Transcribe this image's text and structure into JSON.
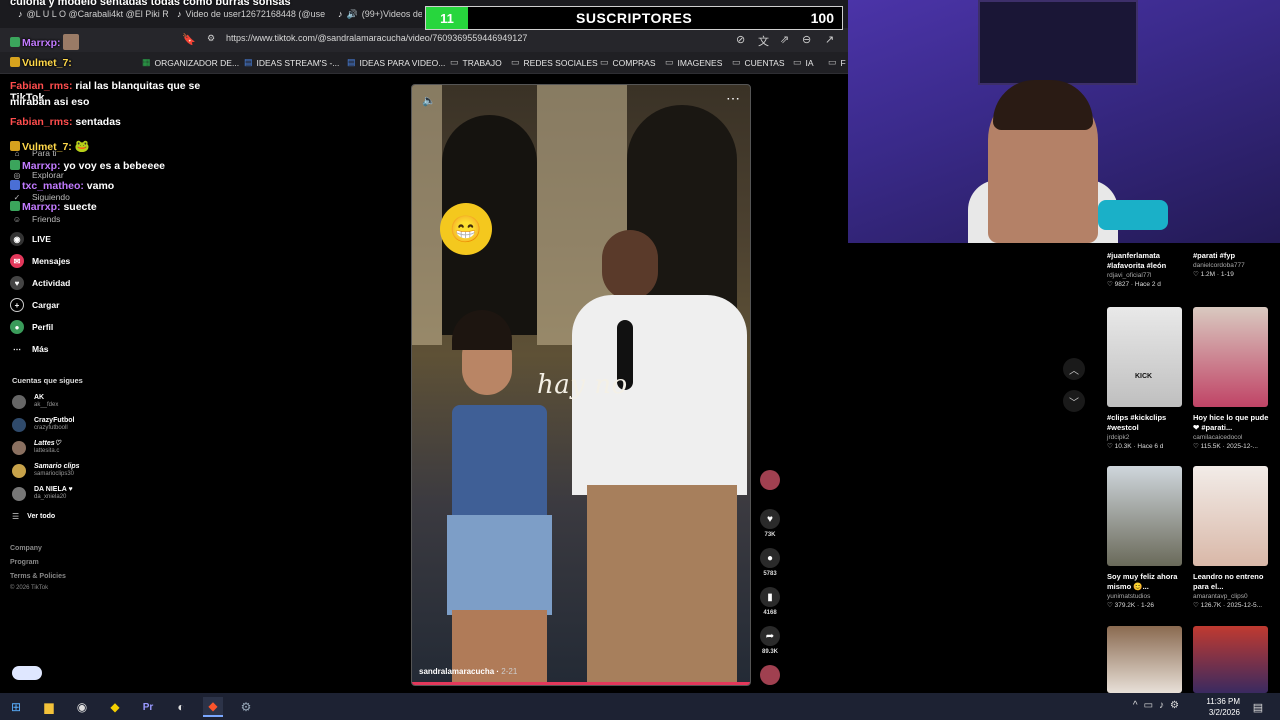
{
  "browser": {
    "tabs": [
      {
        "label": "@L U L O @Carabali4kt @El Piki Rey",
        "icon": "tiktok"
      },
      {
        "label": "Video de user12672168448 (@userm",
        "icon": "tiktok"
      },
      {
        "label": "(99+)Videos de",
        "icon": "tiktok"
      }
    ],
    "url": "https://www.tiktok.com/@sandralamaracucha/video/7609369559446949127",
    "bookmarks": [
      {
        "label": "ORGANIZADOR DE...",
        "icon": "sheet-icon"
      },
      {
        "label": "IDEAS STREAM'S -...",
        "icon": "doc-icon"
      },
      {
        "label": "IDEAS PARA VIDEO...",
        "icon": "doc-icon"
      },
      {
        "label": "TRABAJO",
        "icon": "folder-icon"
      },
      {
        "label": "REDES SOCIALES",
        "icon": "folder-icon"
      },
      {
        "label": "COMPRAS",
        "icon": "folder-icon"
      },
      {
        "label": "IMAGENES",
        "icon": "folder-icon"
      },
      {
        "label": "CUENTAS",
        "icon": "folder-icon"
      },
      {
        "label": "IA",
        "icon": "folder-icon"
      },
      {
        "label": "F",
        "icon": "folder-icon"
      }
    ]
  },
  "overlay": {
    "subs_current": "11",
    "subs_label": "SUSCRIPTORES",
    "subs_goal": "100",
    "header_text": "culona y modelo sentadas todas como burras sonsas"
  },
  "chat": [
    {
      "user": "Marrxp:",
      "text": "",
      "color": "purple"
    },
    {
      "user": "Vulmet_7:",
      "text": "",
      "color": "purple"
    },
    {
      "user": "Fabian_rms:",
      "text": "rial las blanquitas que se miraban asi eso",
      "color": "red"
    },
    {
      "user": "Fabian_rms:",
      "text": "sentadas",
      "color": "red"
    },
    {
      "user": "Vulmet_7:",
      "text": "",
      "color": "yellow"
    },
    {
      "user": "Marrxp:",
      "text": "yo voy es a bebeeee",
      "color": "purple"
    },
    {
      "user": "txc_matheo:",
      "text": "vamo",
      "color": "blue"
    },
    {
      "user": "Marrxp:",
      "text": "suecte",
      "color": "purple"
    }
  ],
  "sidebar": {
    "logo": "TikTok",
    "nav": [
      {
        "label": "Para ti",
        "icon": "home-icon",
        "dim": true
      },
      {
        "label": "Explorar",
        "icon": "compass-icon",
        "dim": true
      },
      {
        "label": "Siguiendo",
        "icon": "following-icon",
        "dim": true
      },
      {
        "label": "Friends",
        "icon": "friends-icon",
        "dim": true
      },
      {
        "label": "LIVE",
        "icon": "live-icon",
        "dim": false
      },
      {
        "label": "Mensajes",
        "icon": "message-icon",
        "dim": false
      },
      {
        "label": "Actividad",
        "icon": "activity-icon",
        "dim": false
      },
      {
        "label": "Cargar",
        "icon": "upload-icon",
        "dim": false
      },
      {
        "label": "Perfil",
        "icon": "profile-icon",
        "dim": false
      },
      {
        "label": "Más",
        "icon": "more-icon",
        "dim": false
      }
    ],
    "following_title": "Cuentas que sigues",
    "accounts": [
      {
        "name": "AK",
        "handle": "ak__fdex"
      },
      {
        "name": "CrazyFutbol",
        "handle": "crazyfutbooll"
      },
      {
        "name": "Lattes♡",
        "handle": "lattesita.c"
      },
      {
        "name": "Samario clips",
        "handle": "samarioclips30"
      },
      {
        "name": "DA NIELA ♥",
        "handle": "da_xniela20"
      }
    ],
    "see_all": "Ver todo",
    "footer": [
      "Company",
      "Program",
      "Terms & Policies",
      "© 2026 TikTok"
    ]
  },
  "video": {
    "author": "sandralamaracucha",
    "date": "2-21",
    "caption": "hay no",
    "likes": "73K",
    "comments": "5783",
    "saves": "4168",
    "shares": "89.3K"
  },
  "recs": [
    {
      "title": "#juanferlamata #lafavorita #león",
      "author": "rdjavi_oficial77l",
      "stats": "♡ 9827 · Hace 2 d"
    },
    {
      "title": "#parati #fyp",
      "author": "danielcordoba777",
      "stats": "♡ 1.2M · 1-19"
    },
    {
      "title": "#clips #kickclips #westcol",
      "author": "jrdcipk2",
      "stats": "♡ 10.3K · Hace 6 d"
    },
    {
      "title": "Hoy hice lo que pude ❤ #parati...",
      "author": "camilacaicedocol",
      "stats": "♡ 115.5K · 2025-12-..."
    },
    {
      "title": "Soy muy feliz ahora mismo 😊...",
      "author": "yunimatstudios",
      "stats": "♡ 379.2K · 1-26"
    },
    {
      "title": "Leandro no entreno para el...",
      "author": "amarantavp_clips0",
      "stats": "♡ 126.7K · 2025-12-5..."
    }
  ],
  "thumb_text": {
    "kick": "KICK"
  },
  "taskbar": {
    "time": "11:36 PM",
    "date": "3/2/2026"
  }
}
